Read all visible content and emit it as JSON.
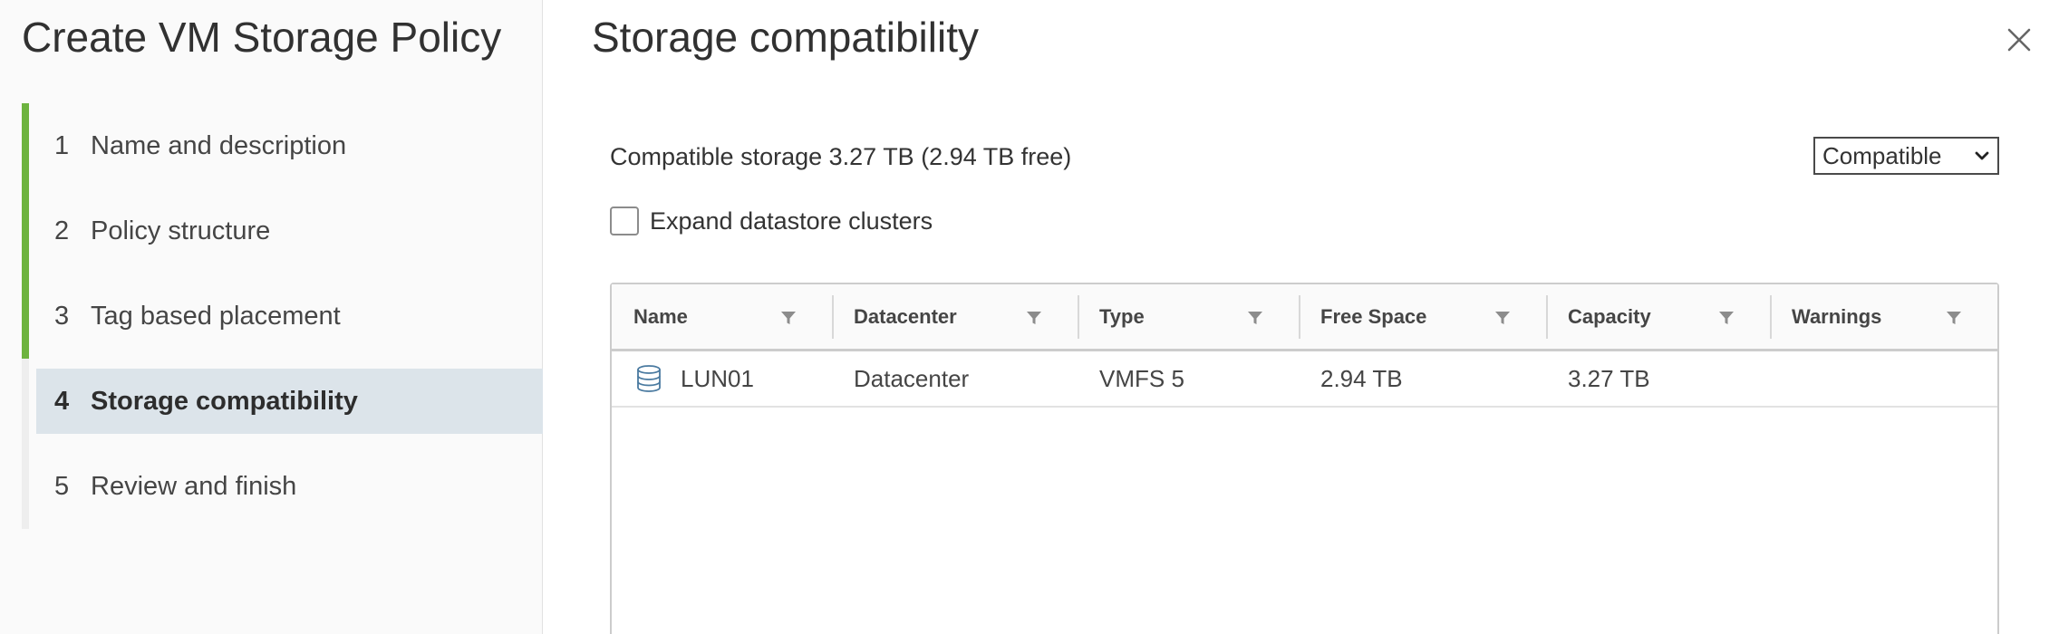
{
  "wizard": {
    "title": "Create VM Storage Policy",
    "steps": [
      {
        "number": "1",
        "label": "Name and description",
        "state": "completed"
      },
      {
        "number": "2",
        "label": "Policy structure",
        "state": "completed"
      },
      {
        "number": "3",
        "label": "Tag based placement",
        "state": "completed"
      },
      {
        "number": "4",
        "label": "Storage compatibility",
        "state": "active"
      },
      {
        "number": "5",
        "label": "Review and finish",
        "state": "pending"
      }
    ]
  },
  "page": {
    "title": "Storage compatibility",
    "close_icon": "close-icon",
    "summary": "Compatible storage 3.27 TB (2.94 TB free)",
    "filter_select": {
      "selected": "Compatible"
    },
    "expand_checkbox": {
      "label": "Expand datastore clusters",
      "checked": false
    }
  },
  "grid": {
    "columns": [
      "Name",
      "Datacenter",
      "Type",
      "Free Space",
      "Capacity",
      "Warnings"
    ],
    "filter_icon": "filter-icon",
    "rows": [
      {
        "icon": "datastore-icon",
        "name": "LUN01",
        "datacenter": "Datacenter",
        "type": "VMFS 5",
        "free_space": "2.94 TB",
        "capacity": "3.27 TB",
        "warnings": ""
      }
    ]
  },
  "colors": {
    "completed_step_bar": "#6db33f",
    "active_step_bg": "#dce4ea",
    "datastore_icon": "#4a7aa0"
  }
}
